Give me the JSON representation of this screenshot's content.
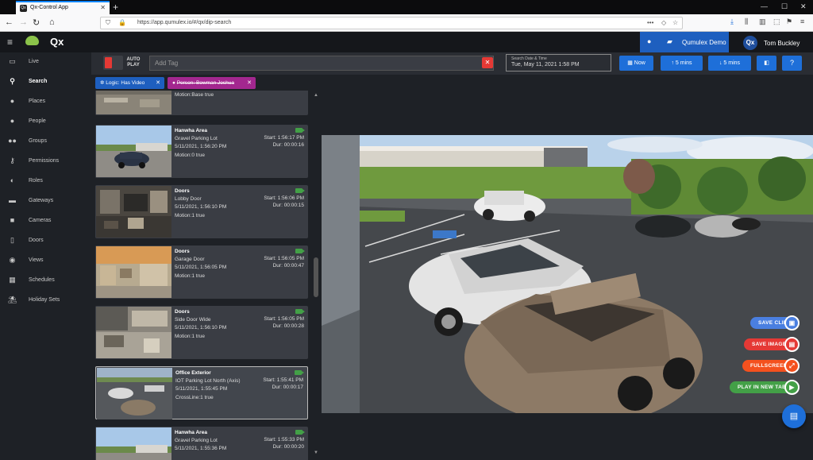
{
  "browser": {
    "tab_title": "Qx-Control App",
    "url": "https://app.qumulex.io/#/qx/dip-search"
  },
  "app": {
    "logo": "Qx",
    "site_name": "Qumulex Demo",
    "user_initials": "Qx",
    "user_name": "Tom Buckley"
  },
  "sidebar": {
    "items": [
      {
        "label": "Live",
        "icon": "monitor-icon"
      },
      {
        "label": "Search",
        "icon": "search-icon",
        "active": true
      },
      {
        "label": "Places",
        "icon": "map-pin-icon"
      },
      {
        "label": "People",
        "icon": "person-icon"
      },
      {
        "label": "Groups",
        "icon": "group-icon"
      },
      {
        "label": "Permissions",
        "icon": "key-icon"
      },
      {
        "label": "Roles",
        "icon": "roles-icon"
      },
      {
        "label": "Gateways",
        "icon": "gateway-icon"
      },
      {
        "label": "Cameras",
        "icon": "camera-icon"
      },
      {
        "label": "Doors",
        "icon": "door-icon"
      },
      {
        "label": "Views",
        "icon": "eye-icon"
      },
      {
        "label": "Schedules",
        "icon": "calendar-icon"
      },
      {
        "label": "Holiday Sets",
        "icon": "holiday-icon"
      }
    ]
  },
  "toolbar": {
    "autoplay_label_1": "AUTO",
    "autoplay_label_2": "PLAY",
    "tag_placeholder": "Add Tag",
    "date_label": "Search Date & Time",
    "date_value": "Tue, May 11, 2021 1:58 PM",
    "now_label": "Now",
    "back_label": "5 mins",
    "forward_label": "5 mins",
    "help_label": "?"
  },
  "filters": [
    {
      "label": "Logic: Has Video",
      "color": "#1e5fbf",
      "icon": "gear-icon"
    },
    {
      "label": "Person: Bowman Joshua",
      "color": "#a3278f",
      "icon": "person-icon",
      "struck": true
    }
  ],
  "results": [
    {
      "title": "",
      "line1": "Motion:Base true",
      "line2": "",
      "line3": "",
      "start": "",
      "dur": ""
    },
    {
      "title": "Hanwha Area",
      "line1": "Gravel Parking Lot",
      "line2": "5/11/2021, 1:56:20 PM",
      "line3": "Motion:0 true",
      "start": "Start: 1:56:17 PM",
      "dur": "Dur: 00:00:16"
    },
    {
      "title": "Doors",
      "line1": "Lobby Door",
      "line2": "5/11/2021, 1:56:10 PM",
      "line3": "Motion:1 true",
      "start": "Start: 1:56:06 PM",
      "dur": "Dur: 00:00:15"
    },
    {
      "title": "Doors",
      "line1": "Garage Door",
      "line2": "5/11/2021, 1:56:05 PM",
      "line3": "Motion:1 true",
      "start": "Start: 1:56:05 PM",
      "dur": "Dur: 00:00:47"
    },
    {
      "title": "Doors",
      "line1": "Side Door Wide",
      "line2": "5/11/2021, 1:56:10 PM",
      "line3": "Motion:1 true",
      "start": "Start: 1:56:05 PM",
      "dur": "Dur: 00:00:28"
    },
    {
      "title": "Office Exterior",
      "line1": "IOT Parking Lot North (Axis)",
      "line2": "5/11/2021, 1:55:45 PM",
      "line3": "CrossLine:1 true",
      "start": "Start: 1:55:41 PM",
      "dur": "Dur: 00:00:17"
    },
    {
      "title": "Hanwha Area",
      "line1": "Gravel Parking Lot",
      "line2": "5/11/2021, 1:55:36 PM",
      "line3": "",
      "start": "Start: 1:55:33 PM",
      "dur": "Dur: 00:00:20"
    }
  ],
  "player_actions": [
    {
      "label": "SAVE CLIP",
      "color": "#4a7fe0",
      "icon": "save-icon"
    },
    {
      "label": "SAVE IMAGE",
      "color": "#e53935",
      "icon": "image-file-icon"
    },
    {
      "label": "FULLSCREEN",
      "color": "#f4511e",
      "icon": "fullscreen-icon"
    },
    {
      "label": "PLAY IN NEW TAB",
      "color": "#43a047",
      "icon": "play-icon"
    }
  ],
  "colors": {
    "accent": "#1e6fd9",
    "sidebar_bg": "#1e2126",
    "card_bg": "#3a3d44",
    "camera_active": "#43a047"
  }
}
